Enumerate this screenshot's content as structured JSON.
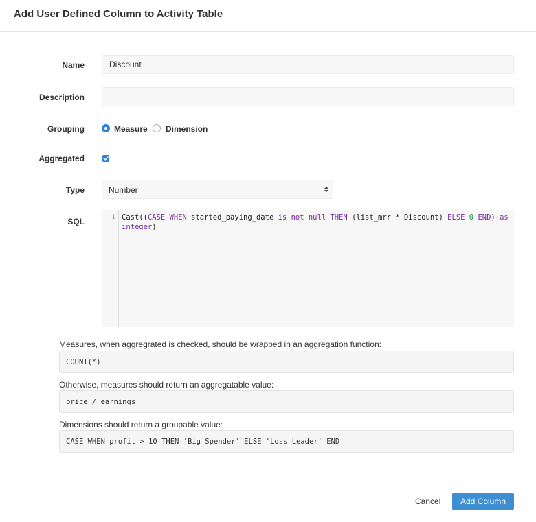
{
  "modal": {
    "title": "Add User Defined Column to Activity Table"
  },
  "form": {
    "name": {
      "label": "Name",
      "value": "Discount"
    },
    "description": {
      "label": "Description",
      "value": ""
    },
    "grouping": {
      "label": "Grouping",
      "options": [
        {
          "label": "Measure",
          "checked": true
        },
        {
          "label": "Dimension",
          "checked": false
        }
      ]
    },
    "aggregated": {
      "label": "Aggregated",
      "checked": true
    },
    "type": {
      "label": "Type",
      "value": "Number"
    },
    "sql": {
      "label": "SQL",
      "line_number": "1",
      "tokens": {
        "t1": "Cast((",
        "t2": "CASE WHEN",
        "t3": " started_paying_date ",
        "t4": "is not null THEN",
        "t5": " (list_mrr * Discount) ",
        "t6": "ELSE",
        "t7": " ",
        "t8": "0",
        "t9": " ",
        "t10": "END",
        "t11": ") ",
        "t12": "as integer",
        "t13": ")"
      }
    }
  },
  "hints": [
    {
      "label": "Measures, when aggregrated is checked, should be wrapped in an aggregation function:",
      "code": "COUNT(*)"
    },
    {
      "label": "Otherwise, measures should return an aggregatable value:",
      "code": "price / earnings"
    },
    {
      "label": "Dimensions should return a groupable value:",
      "code": "CASE WHEN profit > 10 THEN 'Big Spender' ELSE 'Loss Leader' END"
    }
  ],
  "footer": {
    "cancel_label": "Cancel",
    "submit_label": "Add Column"
  },
  "colors": {
    "primary": "#3d8fd1",
    "keyword": "#7a2c9e",
    "number": "#1d8b3e"
  },
  "icons": {
    "select_arrow": "select-arrows-icon",
    "checkbox_check": "checkmark-icon"
  }
}
